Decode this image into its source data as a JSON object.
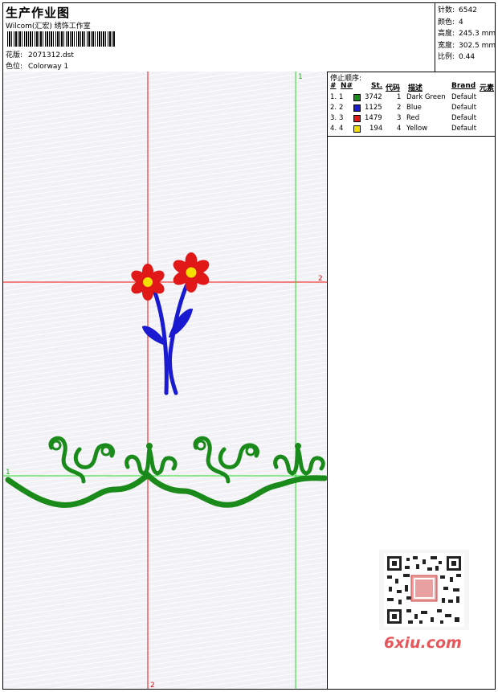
{
  "header": {
    "title": "生产作业图",
    "company": "Wilcom(汇宏) 绣饰工作室",
    "design_label": "花版:",
    "design_value": "2071312.dst",
    "colorway_label": "色位:",
    "colorway_value": "Colorway 1"
  },
  "stats": [
    {
      "label": "针数:",
      "value": "6542"
    },
    {
      "label": "颜色:",
      "value": "4"
    },
    {
      "label": "高度:",
      "value": "245.3 mm"
    },
    {
      "label": "宽度:",
      "value": "302.5 mm"
    },
    {
      "label": "比例:",
      "value": "0.44"
    }
  ],
  "color_list": {
    "title": "停止顺序:",
    "headers": [
      "#",
      "N#",
      "St.",
      "代码",
      "描述",
      "Brand",
      "元素"
    ],
    "rows": [
      {
        "num": "1.",
        "n": "1",
        "stitches": "3742",
        "code": "1",
        "desc": "Dark Green",
        "brand": "Default",
        "color": "#1a8a1a"
      },
      {
        "num": "2.",
        "n": "2",
        "stitches": "1125",
        "code": "2",
        "desc": "Blue",
        "brand": "Default",
        "color": "#1a1ad0"
      },
      {
        "num": "3.",
        "n": "3",
        "stitches": "1479",
        "code": "3",
        "desc": "Red",
        "brand": "Default",
        "color": "#e01818"
      },
      {
        "num": "4.",
        "n": "4",
        "stitches": "194",
        "code": "4",
        "desc": "Yellow",
        "brand": "Default",
        "color": "#f4e000"
      }
    ]
  },
  "guides": {
    "green_vertical_label": "1",
    "green_horizontal_label": "1",
    "red_horizontal_label": "2",
    "red_vertical_label": "2"
  },
  "colors": {
    "guide_red": "#ee1111",
    "guide_green": "#22dd22",
    "thread_green": "#1a8a1a",
    "thread_blue": "#1a1ad0",
    "thread_red": "#e01818",
    "thread_yellow": "#f4e000"
  },
  "watermark": "6xiu.com"
}
